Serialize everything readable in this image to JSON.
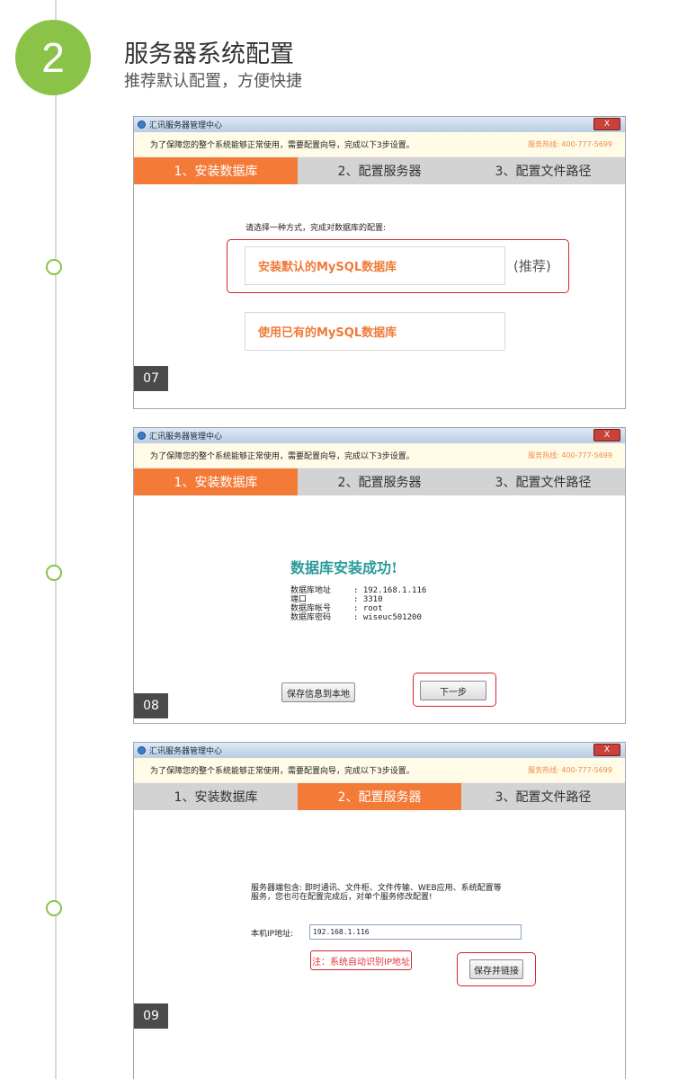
{
  "step": {
    "number": "2",
    "title": "服务器系统配置",
    "subtitle": "推荐默认配置，方便快捷"
  },
  "window": {
    "title": "汇讯服务器管理中心",
    "close_label": "X",
    "notice": "为了保障您的整个系统能够正常使用，需要配置向导，完成以下3步设置。",
    "hotline": "服务热线: 400-777-5699",
    "tabs": [
      "1、安装数据库",
      "2、配置服务器",
      "3、配置文件路径"
    ]
  },
  "screens": [
    {
      "badge": "07",
      "active_tab": 0,
      "prompt": "请选择一种方式，完成对数据库的配置:",
      "option_default": "安装默认的MySQL数据库",
      "recommend": "(推荐)",
      "option_existing": "使用已有的MySQL数据库"
    },
    {
      "badge": "08",
      "active_tab": 0,
      "success_title": "数据库安装成功!",
      "info": [
        {
          "label": "数据库地址",
          "value": ": 192.168.1.116"
        },
        {
          "label": "端口",
          "value": ": 3310"
        },
        {
          "label": "数据库帐号",
          "value": ": root"
        },
        {
          "label": "数据库密码",
          "value": ": wiseuc501200"
        }
      ],
      "save_local_label": "保存信息到本地",
      "next_label": "下一步"
    },
    {
      "badge": "09",
      "active_tab": 1,
      "description_line1": "服务器端包含: 即时通讯、文件柜、文件传输、WEB应用、系统配置等",
      "description_line2": "服务，您也可在配置完成后，对单个服务修改配置!",
      "ip_label": "本机IP地址:",
      "ip_value": "192.168.1.116",
      "note": "注：系统自动识别IP地址",
      "save_link_label": "保存并链接"
    }
  ],
  "colors": {
    "accent": "#f47a38",
    "green": "#8bc349",
    "highlight": "#d6262b",
    "teal": "#2a9a9a"
  }
}
